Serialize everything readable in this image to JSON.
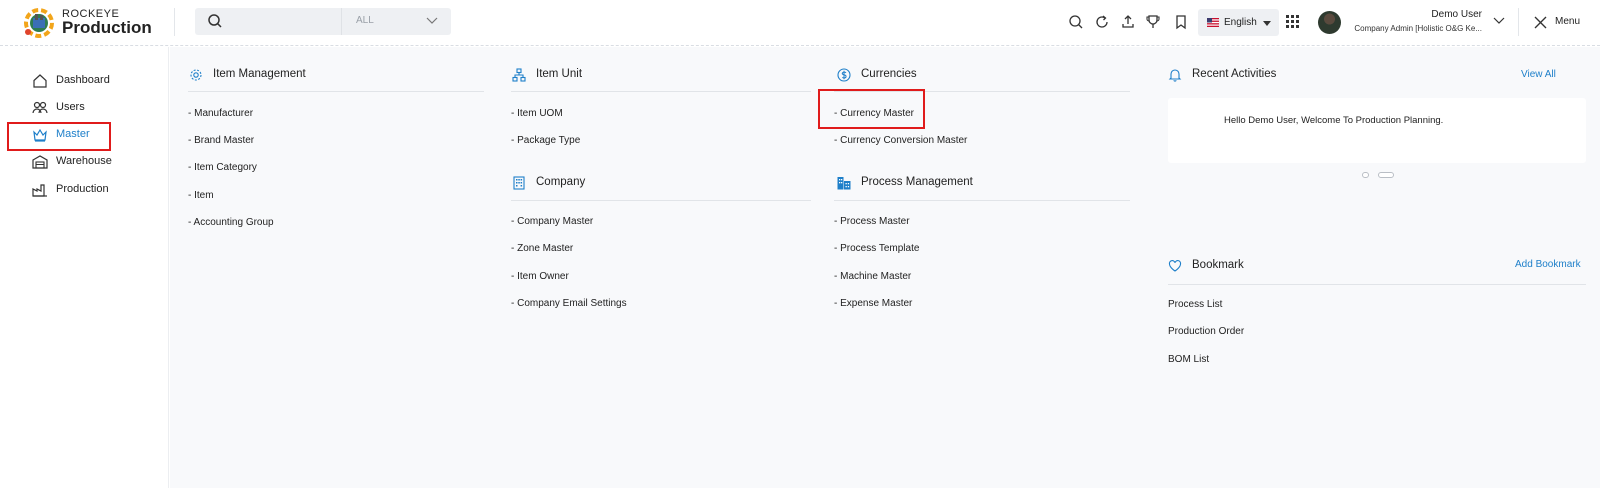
{
  "app": {
    "brand_top": "ROCKEYE",
    "brand_main": "Production"
  },
  "search": {
    "placeholder": "",
    "scope_selected": "ALL"
  },
  "language": {
    "label": "English"
  },
  "user": {
    "name": "Demo User",
    "role": "Company Admin [Holistic O&G Ke..."
  },
  "menu_label": "Menu",
  "sidebar": {
    "items": [
      {
        "label": "Dashboard",
        "icon": "home-icon",
        "active": false
      },
      {
        "label": "Users",
        "icon": "users-icon",
        "active": false
      },
      {
        "label": "Master",
        "icon": "crown-icon",
        "active": true
      },
      {
        "label": "Warehouse",
        "icon": "warehouse-icon",
        "active": false
      },
      {
        "label": "Production",
        "icon": "factory-icon",
        "active": false
      }
    ]
  },
  "sections": {
    "item_management": {
      "title": "Item Management",
      "icon": "gear-icon",
      "links": [
        "- Manufacturer",
        "- Brand Master",
        "- Item Category",
        "- Item",
        "- Accounting Group"
      ]
    },
    "item_unit": {
      "title": "Item Unit",
      "icon": "hierarchy-icon",
      "links": [
        "- Item UOM",
        "- Package Type"
      ]
    },
    "company": {
      "title": "Company",
      "icon": "building-icon",
      "links": [
        "- Company Master",
        "- Zone Master",
        "- Item Owner",
        "- Company Email Settings"
      ]
    },
    "currencies": {
      "title": "Currencies",
      "icon": "dollar-icon",
      "links": [
        "- Currency Master",
        "- Currency Conversion Master"
      ]
    },
    "process_management": {
      "title": "Process Management",
      "icon": "city-icon",
      "links": [
        "- Process Master",
        "- Process Template",
        "- Machine Master",
        "- Expense Master"
      ]
    }
  },
  "recent_activities": {
    "title": "Recent Activities",
    "view_all": "View All",
    "message": "Hello Demo User, Welcome To Production Planning."
  },
  "bookmark": {
    "title": "Bookmark",
    "add_label": "Add Bookmark",
    "items": [
      "Process List",
      "Production Order",
      "BOM List"
    ]
  },
  "colors": {
    "accent": "#1e7fc9",
    "highlight": "#e01b1b"
  }
}
